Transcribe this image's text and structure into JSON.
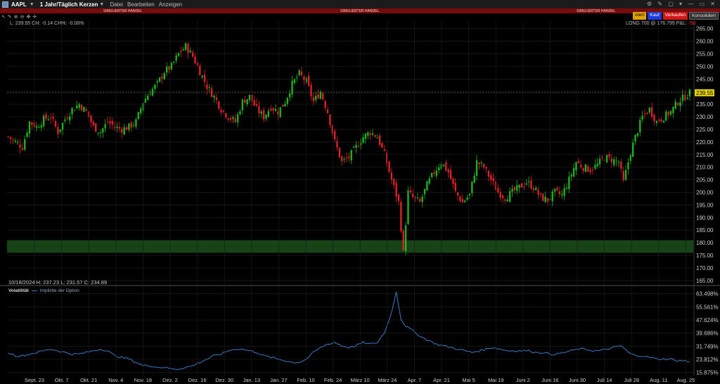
{
  "titlebar": {
    "symbol": "AAPL",
    "period": "1 Jahr/Täglich Kerzen",
    "menus": [
      "Datei",
      "Bearbeiten",
      "Anzeigen"
    ]
  },
  "sim_banner": [
    "SIMULIERTER HANDEL",
    "SIMULIERTER HANDEL",
    "SIMULIERTER HANDEL"
  ],
  "buttons": {
    "alert": "Alert",
    "buy": "Kauf",
    "sell": "Verkaufen",
    "consolidate": "Konsolidiert"
  },
  "quote_line": "L: 239.55 CH: -0.14 CH%: -0.06%",
  "position": {
    "text": "LONG 700 @ 176.795 P&L:",
    "pl": "-50"
  },
  "ohlc_line": "10/18/2024  H: 237.23  L: 231.57  C: 234.89",
  "volatility": {
    "title": "Volatilität",
    "series_name": "Implizite der Option"
  },
  "colors": {
    "up": "#1fb41f",
    "down": "#e0202a",
    "iv_line": "#3a78c0",
    "position_zone": "#1f5a1f",
    "last_price_bg": "#e6d400"
  },
  "chart_data": [
    {
      "type": "candlestick",
      "title": "AAPL 1 Jahr/Täglich Kerzen",
      "ylim": [
        163,
        268
      ],
      "yticks": [
        165,
        170,
        175,
        180,
        185,
        190,
        195,
        200,
        205,
        210,
        215,
        220,
        225,
        230,
        235,
        240,
        245,
        250,
        255,
        260,
        265
      ],
      "ytick_labels": [
        "165.00",
        "170.00",
        "175.00",
        "180.00",
        "185.00",
        "190.00",
        "195.00",
        "200.00",
        "205.00",
        "210.00",
        "215.00",
        "220.00",
        "225.00",
        "230.00",
        "235.00",
        "240.00",
        "245.00",
        "250.00",
        "255.00",
        "260.00",
        "265.00"
      ],
      "last_price": 239.55,
      "last_price_label": "239.55",
      "position_entry": 176.795,
      "position_zone": [
        176,
        181
      ],
      "xtick_labels": [
        "Sept. 23",
        "Okt. 7",
        "Okt. 21",
        "Nov. 4",
        "Nov. 18",
        "Dez. 2",
        "Dez. 16",
        "Dez. 30",
        "Jan. 13",
        "Jan. 27",
        "Feb. 10",
        "Feb. 24",
        "März 10",
        "März 24",
        "Apr. 7",
        "Apr. 21",
        "Mai 5",
        "Mai 19",
        "Juni 2",
        "Juni 16",
        "Juni 30",
        "Juli 14",
        "Juli 28",
        "Aug. 11",
        "Aug. 25"
      ],
      "close_path": [
        [
          0,
          222
        ],
        [
          3,
          220
        ],
        [
          6,
          218
        ],
        [
          9,
          228
        ],
        [
          12,
          226
        ],
        [
          15,
          229
        ],
        [
          18,
          230
        ],
        [
          21,
          224
        ],
        [
          24,
          229
        ],
        [
          27,
          233
        ],
        [
          30,
          235
        ],
        [
          33,
          232
        ],
        [
          36,
          226
        ],
        [
          39,
          224
        ],
        [
          42,
          228
        ],
        [
          45,
          226
        ],
        [
          48,
          225
        ],
        [
          51,
          226
        ],
        [
          54,
          228
        ],
        [
          57,
          236
        ],
        [
          60,
          240
        ],
        [
          63,
          243
        ],
        [
          66,
          248
        ],
        [
          69,
          250
        ],
        [
          72,
          255
        ],
        [
          75,
          258
        ],
        [
          78,
          254
        ],
        [
          81,
          248
        ],
        [
          84,
          242
        ],
        [
          87,
          238
        ],
        [
          90,
          233
        ],
        [
          93,
          230
        ],
        [
          96,
          228
        ],
        [
          99,
          236
        ],
        [
          102,
          238
        ],
        [
          105,
          233
        ],
        [
          108,
          230
        ],
        [
          111,
          234
        ],
        [
          114,
          232
        ],
        [
          117,
          236
        ],
        [
          120,
          243
        ],
        [
          123,
          247
        ],
        [
          126,
          244
        ],
        [
          129,
          236
        ],
        [
          132,
          240
        ],
        [
          135,
          232
        ],
        [
          138,
          220
        ],
        [
          141,
          212
        ],
        [
          144,
          214
        ],
        [
          147,
          218
        ],
        [
          150,
          222
        ],
        [
          153,
          224
        ],
        [
          156,
          222
        ],
        [
          159,
          215
        ],
        [
          162,
          205
        ],
        [
          165,
          196
        ],
        [
          167,
          176
        ],
        [
          169,
          200
        ],
        [
          171,
          198
        ],
        [
          174,
          196
        ],
        [
          177,
          203
        ],
        [
          180,
          208
        ],
        [
          183,
          212
        ],
        [
          186,
          208
        ],
        [
          189,
          200
        ],
        [
          192,
          196
        ],
        [
          195,
          199
        ],
        [
          198,
          212
        ],
        [
          201,
          210
        ],
        [
          204,
          205
        ],
        [
          207,
          200
        ],
        [
          210,
          198
        ],
        [
          213,
          200
        ],
        [
          216,
          202
        ],
        [
          219,
          204
        ],
        [
          222,
          202
        ],
        [
          225,
          198
        ],
        [
          228,
          197
        ],
        [
          231,
          200
        ],
        [
          234,
          199
        ],
        [
          237,
          205
        ],
        [
          240,
          212
        ],
        [
          243,
          210
        ],
        [
          246,
          209
        ],
        [
          249,
          211
        ],
        [
          252,
          214
        ],
        [
          255,
          213
        ],
        [
          258,
          212
        ],
        [
          260,
          204
        ],
        [
          263,
          216
        ],
        [
          265,
          222
        ],
        [
          268,
          230
        ],
        [
          271,
          233
        ],
        [
          274,
          228
        ],
        [
          277,
          230
        ],
        [
          280,
          232
        ],
        [
          283,
          236
        ],
        [
          286,
          238
        ],
        [
          288,
          239.55
        ]
      ]
    },
    {
      "type": "line",
      "title": "Volatilität",
      "series": [
        {
          "name": "Implizite der Option"
        }
      ],
      "ylim": [
        14,
        68
      ],
      "yticks": [
        15.875,
        23.812,
        31.749,
        39.686,
        47.624,
        55.561,
        63.498
      ],
      "ytick_labels": [
        "15.875%",
        "23.812%",
        "31.749%",
        "39.686%",
        "47.624%",
        "55.561%",
        "63.498%"
      ],
      "iv_path": [
        [
          0,
          28
        ],
        [
          3,
          26
        ],
        [
          6,
          26
        ],
        [
          9,
          27
        ],
        [
          12,
          28
        ],
        [
          15,
          29
        ],
        [
          18,
          30
        ],
        [
          21,
          29
        ],
        [
          24,
          28
        ],
        [
          27,
          27
        ],
        [
          30,
          27
        ],
        [
          33,
          28
        ],
        [
          36,
          29
        ],
        [
          39,
          30
        ],
        [
          42,
          29
        ],
        [
          45,
          26
        ],
        [
          48,
          25
        ],
        [
          51,
          24
        ],
        [
          54,
          22
        ],
        [
          57,
          20
        ],
        [
          60,
          20
        ],
        [
          63,
          19
        ],
        [
          66,
          19
        ],
        [
          69,
          18
        ],
        [
          72,
          18
        ],
        [
          75,
          19
        ],
        [
          78,
          20
        ],
        [
          81,
          22
        ],
        [
          84,
          24
        ],
        [
          87,
          26
        ],
        [
          90,
          27
        ],
        [
          93,
          29
        ],
        [
          96,
          30
        ],
        [
          99,
          30
        ],
        [
          102,
          29
        ],
        [
          105,
          28
        ],
        [
          108,
          26
        ],
        [
          111,
          25
        ],
        [
          114,
          24
        ],
        [
          117,
          23
        ],
        [
          120,
          22
        ],
        [
          123,
          22
        ],
        [
          126,
          24
        ],
        [
          129,
          28
        ],
        [
          132,
          31
        ],
        [
          135,
          33
        ],
        [
          138,
          34
        ],
        [
          141,
          32
        ],
        [
          144,
          31
        ],
        [
          147,
          32
        ],
        [
          150,
          34
        ],
        [
          153,
          33
        ],
        [
          156,
          34
        ],
        [
          159,
          40
        ],
        [
          162,
          52
        ],
        [
          164,
          65
        ],
        [
          166,
          48
        ],
        [
          168,
          44
        ],
        [
          170,
          42
        ],
        [
          172,
          40
        ],
        [
          175,
          37
        ],
        [
          178,
          35
        ],
        [
          181,
          33
        ],
        [
          184,
          32
        ],
        [
          187,
          31
        ],
        [
          190,
          30
        ],
        [
          193,
          29
        ],
        [
          196,
          28
        ],
        [
          199,
          29
        ],
        [
          202,
          30
        ],
        [
          205,
          31
        ],
        [
          208,
          30
        ],
        [
          211,
          29
        ],
        [
          214,
          29
        ],
        [
          217,
          29
        ],
        [
          220,
          29
        ],
        [
          223,
          28
        ],
        [
          226,
          28
        ],
        [
          229,
          27
        ],
        [
          232,
          27
        ],
        [
          235,
          28
        ],
        [
          238,
          29
        ],
        [
          241,
          30
        ],
        [
          244,
          30
        ],
        [
          247,
          29
        ],
        [
          250,
          29
        ],
        [
          253,
          30
        ],
        [
          256,
          31
        ],
        [
          259,
          32
        ],
        [
          262,
          28
        ],
        [
          265,
          26
        ],
        [
          268,
          26
        ],
        [
          271,
          25
        ],
        [
          274,
          24
        ],
        [
          277,
          24
        ],
        [
          280,
          24
        ],
        [
          283,
          23
        ],
        [
          286,
          23
        ],
        [
          288,
          22
        ]
      ]
    }
  ]
}
